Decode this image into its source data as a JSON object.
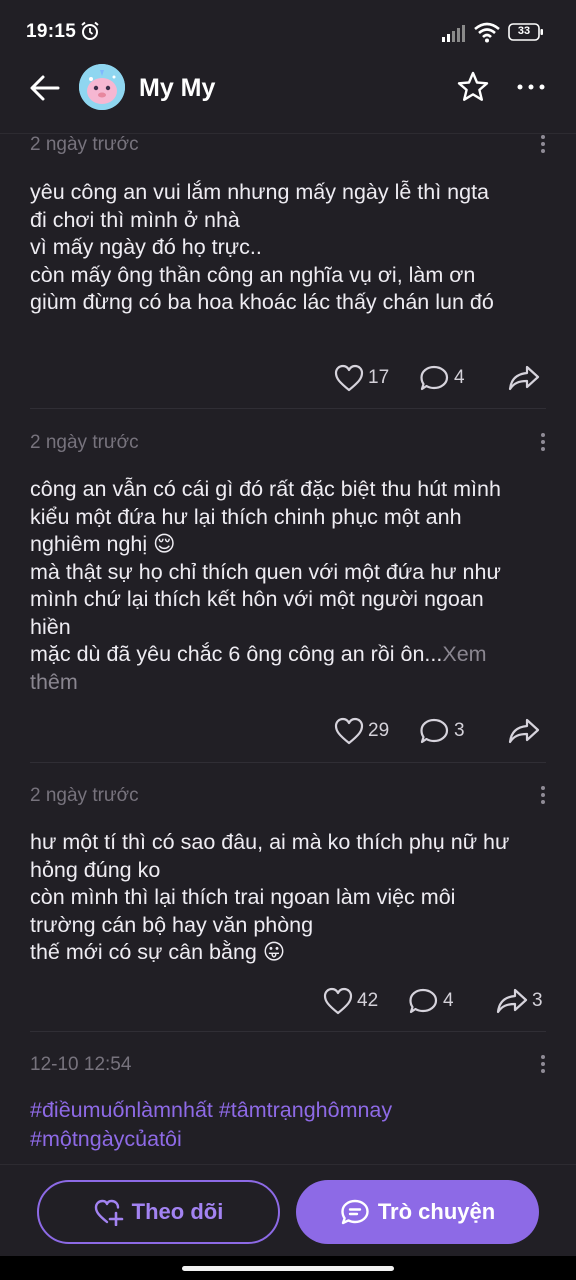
{
  "status_bar": {
    "time": "19:15",
    "battery": "33",
    "icons": [
      "alarm-icon",
      "signal-icon",
      "wifi-icon",
      "battery-icon"
    ]
  },
  "header": {
    "name": "My My",
    "icons": [
      "back-arrow-icon",
      "star-icon",
      "more-horizontal-icon"
    ]
  },
  "posts": [
    {
      "time": "2 ngày trước",
      "body": "yêu công an vui lắm nhưng mấy ngày lễ thì ngta\nđi chơi thì mình ở nhà\nvì mấy ngày đó họ trực..\ncòn mấy ông thần công an nghĩa vụ ơi, làm ơn\ngiùm đừng có ba hoa khoác lác thấy chán lun đó",
      "likes": "17",
      "comments": "4",
      "shares": ""
    },
    {
      "time": "2 ngày trước",
      "body": "công an vẫn có cái gì đó rất đặc biệt thu hút mình\nkiểu một đứa hư lại thích chinh phục một anh\nnghiêm nghị 😌\nmà thật sự họ chỉ thích quen với một đứa hư như\nmình chứ lại thích kết hôn với một người ngoan\nhiền\nmặc dù đã yêu chắc 6 ông công an rồi ôn...",
      "more": "Xem\nthêm",
      "likes": "29",
      "comments": "3",
      "shares": ""
    },
    {
      "time": "2 ngày trước",
      "body": "hư một tí thì có sao đâu, ai mà ko thích phụ nữ hư\nhỏng đúng ko\ncòn mình thì lại thích trai ngoan làm việc môi\ntrường cán bộ hay văn phòng\nthế mới có sự cân bằng 😛",
      "likes": "42",
      "comments": "4",
      "shares": "3"
    },
    {
      "time": "12-10 12:54",
      "tags": "#điềumuốnlàmnhất #tâmtrạnghômnay\n#mộtngàycủatôi"
    }
  ],
  "bottom": {
    "follow_label": "Theo dõi",
    "chat_label": "Trò chuyện"
  },
  "colors": {
    "background": "#211f25",
    "accent": "#8d6ae6",
    "text": "#eeecf2",
    "muted": "#77737d"
  }
}
